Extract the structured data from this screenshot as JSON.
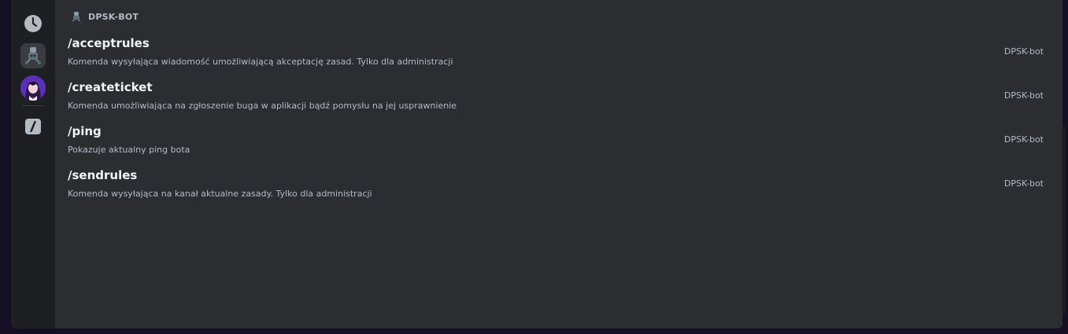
{
  "rail": {
    "icons": [
      "clock-icon",
      "bot-avatar-icon",
      "user-avatar-icon",
      "slash-command-icon"
    ]
  },
  "section": {
    "title": "DPSK-BOT"
  },
  "commands": [
    {
      "name": "/acceptrules",
      "description": "Komenda wysyłająca wiadomość umożliwiającą akceptację zasad. Tylko dla administracji",
      "app": "DPSK-bot"
    },
    {
      "name": "/createticket",
      "description": "Komenda umożliwiająca na zgłoszenie buga w aplikacji bądź pomysłu na jej usprawnienie",
      "app": "DPSK-bot"
    },
    {
      "name": "/ping",
      "description": "Pokazuje aktualny ping bota",
      "app": "DPSK-bot"
    },
    {
      "name": "/sendrules",
      "description": "Komenda wysyłająca na kanał aktualne zasady. Tylko dla administracji",
      "app": "DPSK-bot"
    }
  ],
  "colors": {
    "background": "#140f24",
    "panel": "#2b2d31",
    "rail": "#1e1f22",
    "text_primary": "#f2f3f5",
    "text_secondary": "#b5bac1"
  }
}
